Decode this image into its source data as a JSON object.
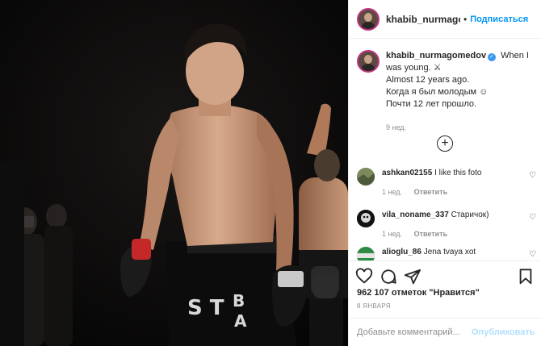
{
  "post": {
    "author": "khabib_nurmagomedov",
    "header_username": "khabib_nurmagom",
    "follow_label": "Подписаться",
    "dot": "•",
    "caption": {
      "line1": "When I was young.",
      "line1_emoji": "⚔",
      "line2": "Almost 12 years ago.",
      "line3": "Когда я был молодым",
      "line3_emoji": "☺",
      "line4": "Почти 12 лет прошло."
    },
    "caption_time": "9 нед.",
    "verified_glyph": "✓",
    "load_more_icon": "plus-circle-icon",
    "comments": [
      {
        "username": "ashkan02155",
        "text": "I like this foto",
        "time": "1 нед.",
        "reply": "Ответить"
      },
      {
        "username": "vila_noname_337",
        "text": "Старичок)",
        "time": "1 нед.",
        "reply": "Ответить"
      },
      {
        "username": "alioglu_86",
        "text": "Jena tvaya xot"
      }
    ],
    "likes": "962 107 отметок \"Нравится\"",
    "date": "8 ЯНВАРЯ",
    "add_comment_placeholder": "Добавьте комментарий...",
    "publish_label": "Опубликовать",
    "accent_color": "#0095f6"
  }
}
